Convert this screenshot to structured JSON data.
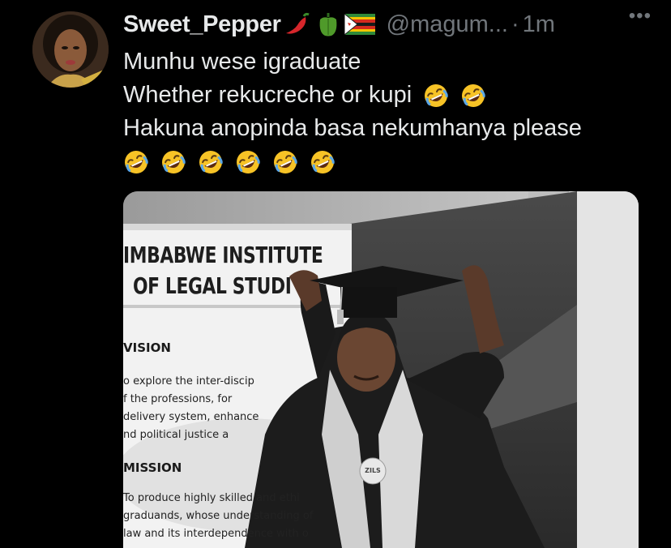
{
  "tweet": {
    "display_name": "Sweet_Pepper",
    "name_emojis": [
      "hot-pepper-emoji",
      "bell-pepper-emoji",
      "zimbabwe-flag-emoji"
    ],
    "handle": "@magum...",
    "separator": "·",
    "time": "1m",
    "more_label": "•••",
    "text_lines": [
      "Munhu wese igraduate",
      "Whether rekucreche or kupi",
      "Hakuna anopinda basa nekumhanya please"
    ],
    "emoji": "rolling-on-the-floor-laughing-emoji",
    "line2_emoji_count": 2,
    "line4_emoji_count": 6
  },
  "media": {
    "banner_title_line1": "IMBABWE INSTITUTE",
    "banner_title_line2": "OF LEGAL STUDI",
    "vision_heading": "VISION",
    "vision_lines": [
      "o explore the inter-discip",
      "f the professions, for",
      "delivery system, enhance",
      "nd political justice a"
    ],
    "mission_heading": "MISSION",
    "mission_lines": [
      "To produce highly skilled and ethi",
      "graduands, whose understanding of",
      "law and its interdependence with o"
    ],
    "badge_text": "ZILS"
  }
}
